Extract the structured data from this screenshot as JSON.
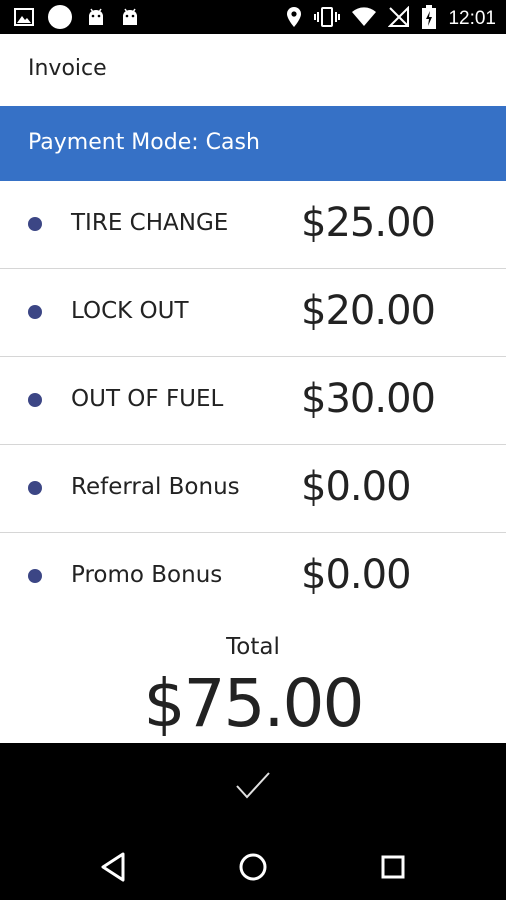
{
  "status_bar": {
    "time": "12:01",
    "icons_left": [
      "image-icon",
      "circle-icon",
      "android-icon",
      "android-icon"
    ],
    "icons_right": [
      "location-icon",
      "vibrate-icon",
      "wifi-icon",
      "no-signal-icon",
      "battery-charging-icon"
    ]
  },
  "app_bar": {
    "title": "Invoice"
  },
  "payment_mode": {
    "text": "Payment Mode: Cash",
    "color": "#3671c6"
  },
  "items": [
    {
      "label": "TIRE CHANGE",
      "amount": "$25.00"
    },
    {
      "label": "LOCK OUT",
      "amount": "$20.00"
    },
    {
      "label": "OUT OF FUEL",
      "amount": "$30.00"
    },
    {
      "label": "Referral Bonus",
      "amount": "$0.00"
    },
    {
      "label": "Promo Bonus",
      "amount": "$0.00"
    }
  ],
  "total": {
    "label": "Total",
    "value": "$75.00"
  },
  "confirm_button": {
    "icon": "checkmark-icon"
  },
  "nav_bar": {
    "buttons": [
      "back-icon",
      "home-icon",
      "recents-icon"
    ]
  },
  "colors": {
    "bullet": "#3c4685",
    "accent": "#3671c6"
  }
}
